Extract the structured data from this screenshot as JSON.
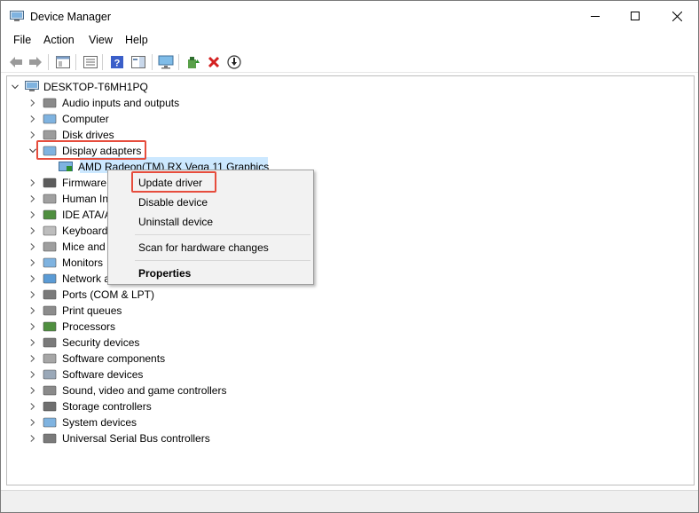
{
  "window": {
    "title": "Device Manager",
    "controls": {
      "minimize": "minimize-icon",
      "maximize": "maximize-icon",
      "close": "close-icon"
    }
  },
  "menu": [
    "File",
    "Action",
    "View",
    "Help"
  ],
  "toolbar": [
    "back-icon",
    "forward-icon",
    "properties-pane-icon",
    "list-icon",
    "help-icon",
    "action-pane-icon",
    "monitor-scan-icon",
    "update-driver-icon",
    "uninstall-icon",
    "disable-icon"
  ],
  "tree": {
    "root": "DESKTOP-T6MH1PQ",
    "categories": [
      {
        "label": "Audio inputs and outputs",
        "icon": "speaker-icon"
      },
      {
        "label": "Computer",
        "icon": "computer-icon"
      },
      {
        "label": "Disk drives",
        "icon": "disk-icon"
      },
      {
        "label": "Display adapters",
        "icon": "display-adapter-icon",
        "expanded": true,
        "children": [
          "AMD Radeon(TM) RX Vega 11 Graphics"
        ]
      },
      {
        "label": "Firmware",
        "icon": "firmware-icon"
      },
      {
        "label": "Human In",
        "icon": "hid-icon"
      },
      {
        "label": "IDE ATA/A",
        "icon": "ide-icon"
      },
      {
        "label": "Keyboards",
        "icon": "keyboard-icon"
      },
      {
        "label": "Mice and",
        "icon": "mouse-icon"
      },
      {
        "label": "Monitors",
        "icon": "monitor-icon"
      },
      {
        "label": "Network a",
        "icon": "network-icon"
      },
      {
        "label": "Ports (COM & LPT)",
        "icon": "port-icon"
      },
      {
        "label": "Print queues",
        "icon": "printer-icon"
      },
      {
        "label": "Processors",
        "icon": "processor-icon"
      },
      {
        "label": "Security devices",
        "icon": "security-icon"
      },
      {
        "label": "Software components",
        "icon": "software-component-icon"
      },
      {
        "label": "Software devices",
        "icon": "software-device-icon"
      },
      {
        "label": "Sound, video and game controllers",
        "icon": "sound-icon"
      },
      {
        "label": "Storage controllers",
        "icon": "storage-icon"
      },
      {
        "label": "System devices",
        "icon": "system-icon"
      },
      {
        "label": "Universal Serial Bus controllers",
        "icon": "usb-icon"
      }
    ]
  },
  "context_menu": {
    "items": [
      "Update driver",
      "Disable device",
      "Uninstall device",
      "Scan for hardware changes",
      "Properties"
    ]
  },
  "colors": {
    "highlight": "#e64d3d",
    "selection": "#cce8ff",
    "menu_bg": "#f2f2f2"
  }
}
